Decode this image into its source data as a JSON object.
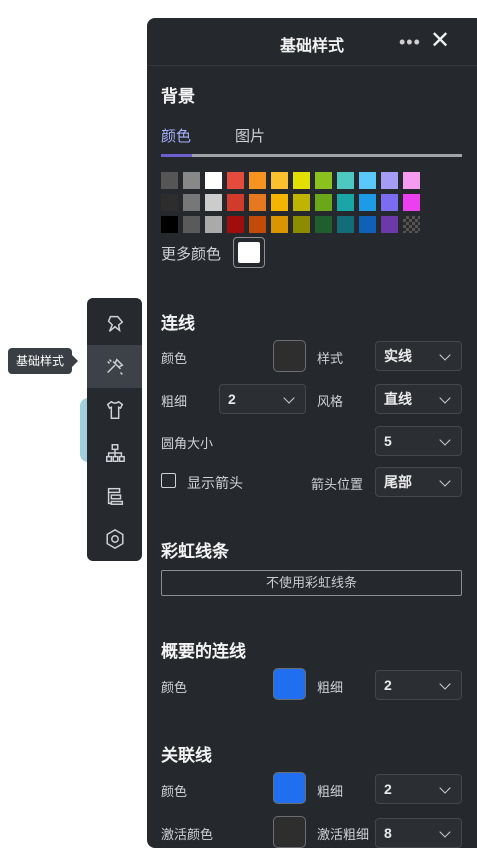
{
  "toolbar": {
    "tooltip": "基础样式",
    "tools": [
      "pin-icon",
      "style-brush-icon",
      "shirt-icon",
      "structure-icon",
      "outline-icon",
      "settings-icon"
    ]
  },
  "panel": {
    "title": "基础样式",
    "more": "•••",
    "close": "✕"
  },
  "background": {
    "title": "背景",
    "tabs": [
      "颜色",
      "图片"
    ],
    "active_tab": "颜色",
    "palette": [
      "#555555",
      "#888888",
      "#ffffff",
      "#e54b3c",
      "#f7931e",
      "#fbc02d",
      "#e1e000",
      "#8bc11d",
      "#4ec9c2",
      "#5ac8fa",
      "#a49cf5",
      "#f59cf0",
      "#2d2d2d",
      "#777777",
      "#cccccc",
      "#d23b2c",
      "#e6781f",
      "#f5b400",
      "#bfb400",
      "#6aa81a",
      "#1aa6a6",
      "#1e9be6",
      "#7b6cf2",
      "#ec3ff0",
      "#000000",
      "#5a5a5a",
      "#aaaaaa",
      "#a10d0d",
      "#c24b0a",
      "#d99600",
      "#8c8c00",
      "#1f5e2d",
      "#126d78",
      "#0f61b8",
      "#6b3aa8",
      "checker"
    ],
    "more_colors": "更多颜色",
    "current_color": "#ffffff"
  },
  "line": {
    "title": "连线",
    "color_label": "颜色",
    "color_value": "#2e2e2e",
    "style_label": "样式",
    "style_value": "实线",
    "width_label": "粗细",
    "width_value": "2",
    "kind_label": "风格",
    "kind_value": "直线",
    "radius_label": "圆角大小",
    "radius_value": "5",
    "show_arrow_label": "显示箭头",
    "show_arrow_checked": false,
    "arrow_pos_label": "箭头位置",
    "arrow_pos_value": "尾部"
  },
  "rainbow": {
    "title": "彩虹线条",
    "button": "不使用彩虹线条"
  },
  "summary_line": {
    "title": "概要的连线",
    "color_label": "颜色",
    "color_value": "#1f6ff0",
    "width_label": "粗细",
    "width_value": "2"
  },
  "relation_line": {
    "title": "关联线",
    "color_label": "颜色",
    "color_value": "#1f6ff0",
    "width_label": "粗细",
    "width_value": "2",
    "active_color_label": "激活颜色",
    "active_color_value": "#2e2e2e",
    "active_width_label": "激活粗细",
    "active_width_value": "8"
  }
}
